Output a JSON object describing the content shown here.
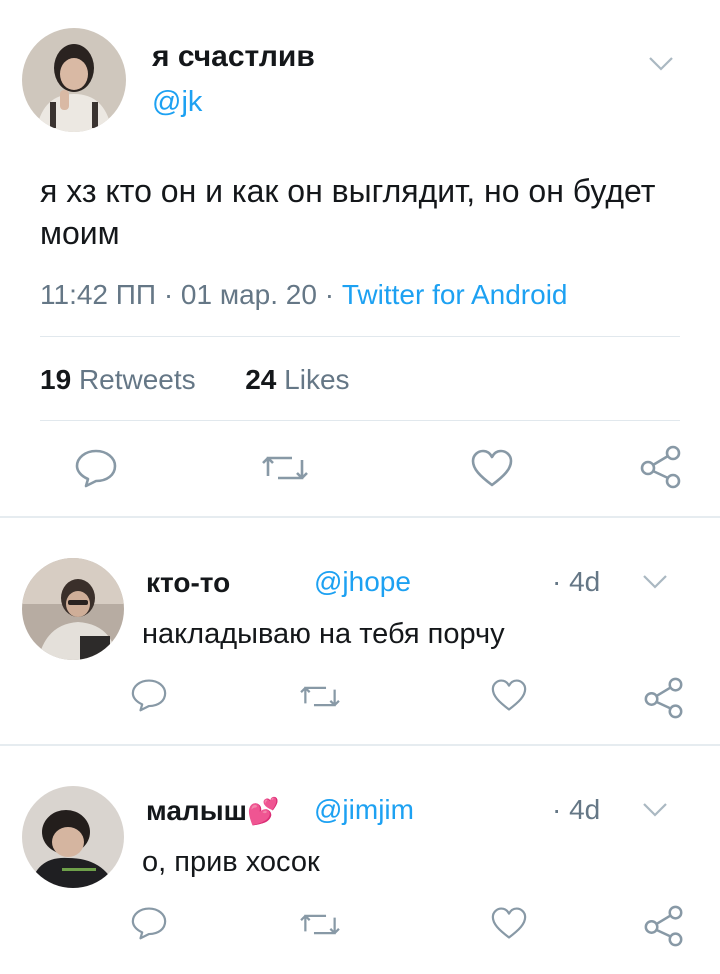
{
  "tweet": {
    "author_name": "я счастлив",
    "author_handle": "@jk",
    "text": "я хз кто он и как он выглядит, но он будет моим",
    "time": "11:42 ПП",
    "sep1": "·",
    "date": "01 мар. 20",
    "sep2": "·",
    "source": "Twitter for Android",
    "retweets_count": "19",
    "retweets_label": "Retweets",
    "likes_count": "24",
    "likes_label": "Likes"
  },
  "replies": [
    {
      "name": "кто-то",
      "handle": "@jhope",
      "time": "· 4d",
      "text": "накладываю на тебя порчу",
      "emoji": ""
    },
    {
      "name": "малыш",
      "handle": "@jimjim",
      "time": "· 4d",
      "text": "о, прив хосок",
      "emoji": "💕"
    }
  ],
  "icons": {
    "reply": "reply-icon",
    "retweet": "retweet-icon",
    "like": "heart-icon",
    "share": "share-icon",
    "caret": "chevron-down-icon"
  },
  "colors": {
    "accent": "#1da1f2",
    "secondary_text": "#657786",
    "icon_gray": "#8899a6",
    "divider": "#e1e8ed"
  }
}
